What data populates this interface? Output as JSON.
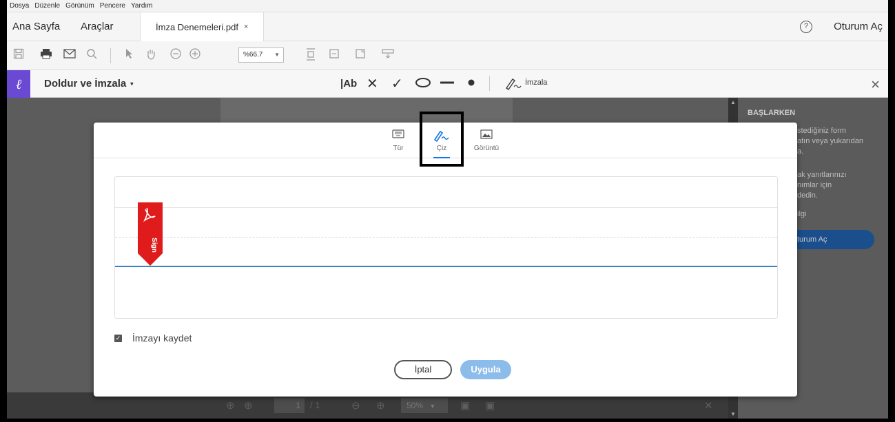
{
  "menubar": {
    "items": [
      "Dosya",
      "Düzenle",
      "Görünüm",
      "Pencere",
      "Yardım"
    ]
  },
  "tabbar": {
    "home": "Ana Sayfa",
    "tools": "Araçlar",
    "doc_tab": "İmza Denemeleri.pdf",
    "doc_close": "×",
    "help": "?",
    "sign_in": "Oturum Aç"
  },
  "toolbar": {
    "zoom": "%66.7"
  },
  "fill_sign": {
    "title": "Doldur ve İmzala",
    "sign_label": "İmzala",
    "close": "×"
  },
  "modal": {
    "tabs": [
      {
        "label": "Tür",
        "icon": "keyboard-icon"
      },
      {
        "label": "Çiz",
        "icon": "draw-pen-icon"
      },
      {
        "label": "Görüntü",
        "icon": "image-icon"
      }
    ],
    "active_tab": "Çiz",
    "sign_flag_text": "Sign",
    "save_label": "İmzayı kaydet",
    "save_checked": true,
    "cancel": "İptal",
    "apply": "Uygula"
  },
  "right_pane": {
    "title": "BAŞLARKEN",
    "lines": [
      "stediğiniz form",
      "atın veya yukarıdan",
      "a.",
      "ak yanıtlarınızı",
      "nımlar için",
      "dedin.",
      "ilgi"
    ],
    "button": "turum Aç"
  },
  "bottombar": {
    "page_current": "1",
    "page_sep": "/ 1",
    "zoom": "50%"
  },
  "colors": {
    "accent_blue": "#1473e6",
    "fill_sign_purple": "#6a4ad2",
    "sign_flag_red": "#e01b1b",
    "apply_button": "#8cbcea"
  }
}
